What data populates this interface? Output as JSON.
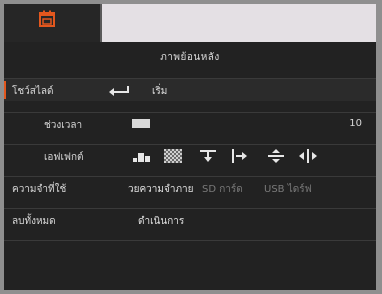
{
  "header": {
    "title": "ภาพย้อนหลัง"
  },
  "rows": {
    "slideshow": {
      "label": "โชว์สไลด์",
      "action": "เริ่ม"
    },
    "interval": {
      "label": "ช่วงเวลา",
      "value": "10"
    },
    "effect": {
      "label": "เอฟเฟกต์"
    },
    "memory": {
      "label": "ความจำที่ใช้",
      "options": [
        "วยความจำภาย",
        "SD การ์ด",
        "USB ไดร์ฟ"
      ]
    },
    "delete_all": {
      "label": "ลบทั้งหมด",
      "action": "ดำเนินการ"
    }
  },
  "icons": [
    "calendar-icon",
    "enter-icon",
    "slider-knob",
    "effect-bars-icon",
    "effect-dissolve-icon",
    "effect-wipe-down-icon",
    "effect-wipe-right-icon",
    "effect-split-vertical-icon",
    "effect-split-horizontal-icon"
  ],
  "colors": {
    "accent": "#e2571e",
    "panel": "#222222",
    "preview": "#e4e0e4"
  }
}
